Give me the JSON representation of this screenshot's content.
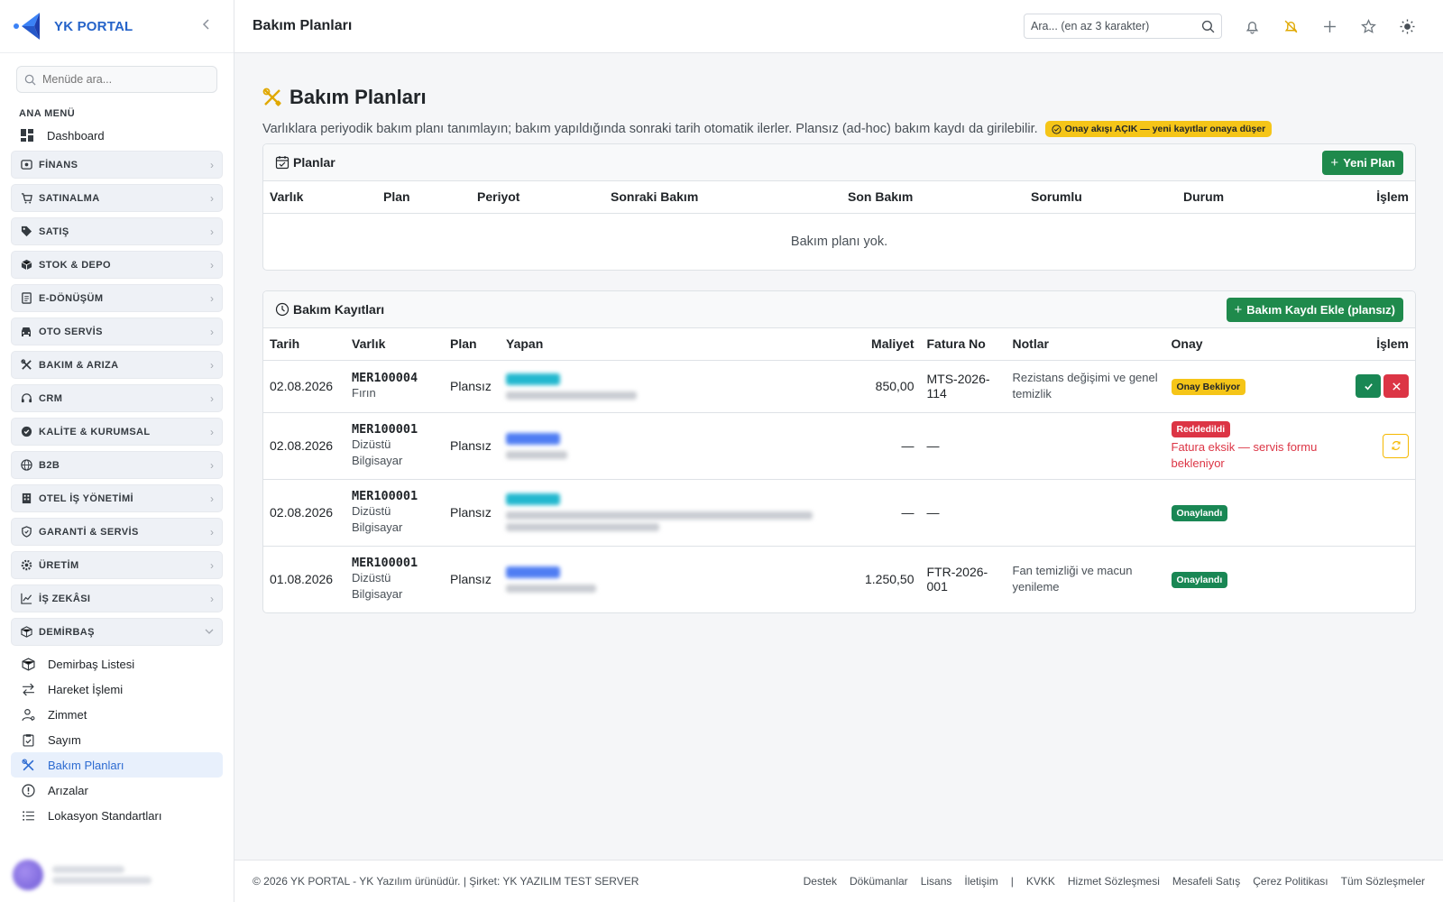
{
  "brand": {
    "name": "YK PORTAL",
    "accent": "#2563c9"
  },
  "sidebar": {
    "search_placeholder": "Menüde ara...",
    "heading": "ANA MENÜ",
    "dashboard": "Dashboard",
    "groups": [
      {
        "label": "FİNANS",
        "icon": "finance-icon"
      },
      {
        "label": "SATINALMA",
        "icon": "cart-icon"
      },
      {
        "label": "SATIŞ",
        "icon": "tag-icon"
      },
      {
        "label": "STOK & DEPO",
        "icon": "box-icon"
      },
      {
        "label": "E-DÖNÜŞÜM",
        "icon": "document-icon"
      },
      {
        "label": "OTO SERVİS",
        "icon": "car-icon"
      },
      {
        "label": "BAKIM & ARIZA",
        "icon": "tools-icon"
      },
      {
        "label": "CRM",
        "icon": "headset-icon"
      },
      {
        "label": "KALİTE & KURUMSAL",
        "icon": "badge-check-icon"
      },
      {
        "label": "B2B",
        "icon": "globe-icon"
      },
      {
        "label": "OTEL İŞ YÖNETİMİ",
        "icon": "building-icon"
      },
      {
        "label": "GARANTİ & SERVİS",
        "icon": "shield-icon"
      },
      {
        "label": "ÜRETİM",
        "icon": "gear-icon"
      },
      {
        "label": "İŞ ZEKÂSI",
        "icon": "chart-icon"
      },
      {
        "label": "DEMİRBAŞ",
        "icon": "asset-box-icon"
      }
    ],
    "sub_items": [
      {
        "label": "Demirbaş Listesi",
        "icon": "box-icon"
      },
      {
        "label": "Hareket İşlemi",
        "icon": "arrows-icon"
      },
      {
        "label": "Zimmet",
        "icon": "user-assign-icon"
      },
      {
        "label": "Sayım",
        "icon": "clipboard-icon"
      },
      {
        "label": "Bakım Planları",
        "icon": "tools-icon",
        "active": true
      },
      {
        "label": "Arızalar",
        "icon": "alert-circle-icon"
      },
      {
        "label": "Lokasyon Standartları",
        "icon": "list-icon"
      }
    ]
  },
  "topbar": {
    "title": "Bakım Planları",
    "search_placeholder": "Ara... (en az 3 karakter)"
  },
  "page": {
    "title": "Bakım Planları",
    "description": "Varlıklara periyodik bakım planı tanımlayın; bakım yapıldığında sonraki tarih otomatik ilerler. Plansız (ad-hoc) bakım kaydı da girilebilir.",
    "flow_badge": "Onay akışı AÇIK — yeni kayıtlar onaya düşer"
  },
  "plans": {
    "title": "Planlar",
    "new_button": "Yeni Plan",
    "columns": [
      "Varlık",
      "Plan",
      "Periyot",
      "Sonraki Bakım",
      "Son Bakım",
      "Sorumlu",
      "Durum",
      "İşlem"
    ],
    "empty": "Bakım planı yok."
  },
  "records": {
    "title": "Bakım Kayıtları",
    "add_button": "Bakım Kaydı Ekle (plansız)",
    "columns": [
      "Tarih",
      "Varlık",
      "Plan",
      "Yapan",
      "Maliyet",
      "Fatura No",
      "Notlar",
      "Onay",
      "İşlem"
    ],
    "rows": [
      {
        "date": "02.08.2026",
        "asset_code": "MER100004",
        "asset_name": "Fırın",
        "plan": "Plansız",
        "cost": "850,00",
        "invoice": "MTS-2026-114",
        "notes": "Rezistans değişimi ve genel temizlik",
        "status": "Onay Bekliyor",
        "status_kind": "pending",
        "reject_note": ""
      },
      {
        "date": "02.08.2026",
        "asset_code": "MER100001",
        "asset_name": "Dizüstü Bilgisayar",
        "plan": "Plansız",
        "cost": "—",
        "invoice": "—",
        "notes": "",
        "status": "Reddedildi",
        "status_kind": "rejected",
        "reject_note": "Fatura eksik — servis formu bekleniyor"
      },
      {
        "date": "02.08.2026",
        "asset_code": "MER100001",
        "asset_name": "Dizüstü Bilgisayar",
        "plan": "Plansız",
        "cost": "—",
        "invoice": "—",
        "notes": "",
        "status": "Onaylandı",
        "status_kind": "approved",
        "reject_note": ""
      },
      {
        "date": "01.08.2026",
        "asset_code": "MER100001",
        "asset_name": "Dizüstü Bilgisayar",
        "plan": "Plansız",
        "cost": "1.250,50",
        "invoice": "FTR-2026-001",
        "notes": "Fan temizliği ve macun yenileme",
        "status": "Onaylandı",
        "status_kind": "approved",
        "reject_note": ""
      }
    ]
  },
  "footer": {
    "copyright": "© 2026 YK PORTAL - YK Yazılım ürünüdür. | Şirket: YK YAZILIM TEST SERVER",
    "links_left": [
      "Destek",
      "Dökümanlar",
      "Lisans",
      "İletişim"
    ],
    "separator": "|",
    "links_right": [
      "KVKK",
      "Hizmet Sözleşmesi",
      "Mesafeli Satış",
      "Çerez Politikası",
      "Tüm Sözleşmeler"
    ]
  },
  "colors": {
    "primary_green": "#1f8a4c",
    "pending": "#f5c518",
    "rejected": "#dc3545",
    "approved": "#198754",
    "active_menu_bg": "#e8f0fc"
  }
}
